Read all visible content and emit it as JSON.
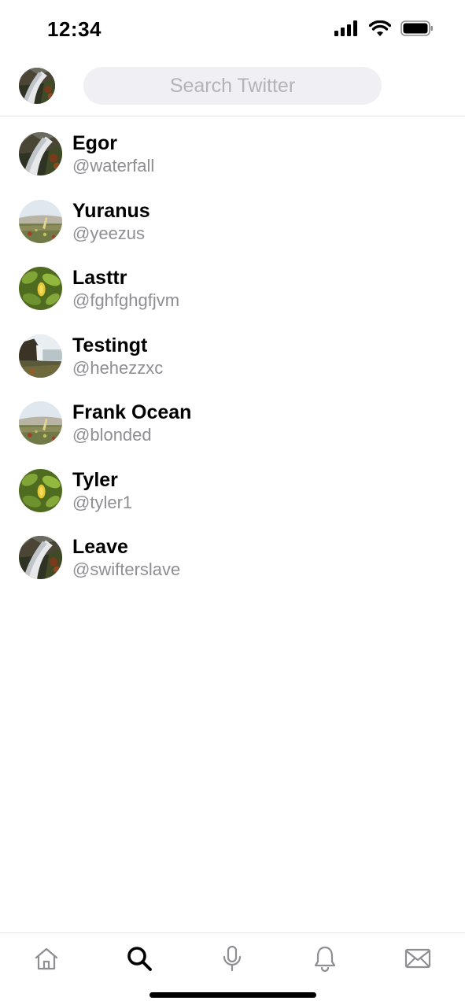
{
  "status_bar": {
    "time": "12:34"
  },
  "search": {
    "placeholder": "Search Twitter",
    "value": ""
  },
  "users": [
    {
      "name": "Egor",
      "handle": "@waterfall",
      "avatar": "waterfall"
    },
    {
      "name": "Yuranus",
      "handle": "@yeezus",
      "avatar": "meadow"
    },
    {
      "name": "Lasttr",
      "handle": "@fghfghgfjvm",
      "avatar": "leaves"
    },
    {
      "name": "Testingt",
      "handle": "@hehezzxc",
      "avatar": "cliff"
    },
    {
      "name": "Frank Ocean",
      "handle": "@blonded",
      "avatar": "meadow"
    },
    {
      "name": "Tyler",
      "handle": "@tyler1",
      "avatar": "leaves"
    },
    {
      "name": "Leave",
      "handle": "@swifterslave",
      "avatar": "waterfall"
    }
  ],
  "tab_bar": {
    "tabs": [
      {
        "icon": "home-icon",
        "active": false
      },
      {
        "icon": "search-icon",
        "active": true
      },
      {
        "icon": "microphone-icon",
        "active": false
      },
      {
        "icon": "bell-icon",
        "active": false
      },
      {
        "icon": "mail-icon",
        "active": false
      }
    ]
  },
  "colors": {
    "handle_gray": "#8e8e93",
    "search_bg": "#efeff4",
    "placeholder_gray": "#b3b3b8",
    "inactive_icon": "#8e8e93",
    "active_icon": "#000000"
  }
}
